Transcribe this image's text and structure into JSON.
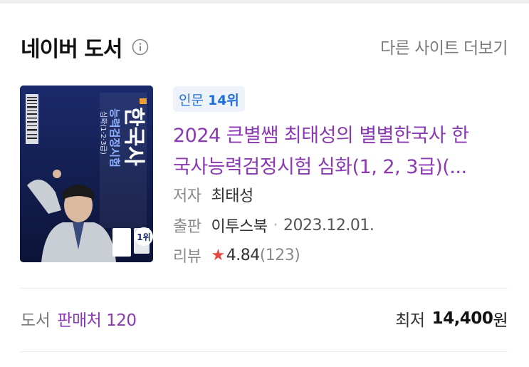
{
  "header": {
    "title": "네이버 도서",
    "more_link": "다른 사이트 더보기"
  },
  "book": {
    "cover": {
      "title_text": "한국사",
      "subtitle_text": "능력검정시험",
      "level_text": "심화(1·2·3급)",
      "badge_text": "1위"
    },
    "rank_category": "인문",
    "rank_value": "14위",
    "title_line1": "2024 큰별쌤 최태성의 별별한국사 한",
    "title_line2": "국사능력검정시험 심화(1, 2, 3급)(...",
    "author_label": "저자",
    "author": "최태성",
    "publisher_label": "출판",
    "publisher": "이투스북",
    "date": "2023.12.01.",
    "review_label": "리뷰",
    "rating": "4.84",
    "review_count": "(123)"
  },
  "footer": {
    "category": "도서",
    "sellers": "판매처 120",
    "min_label": "최저",
    "price": "14,400",
    "currency": "원"
  },
  "colors": {
    "accent_purple": "#8b3ab3",
    "badge_blue": "#1f6fd6",
    "star_red": "#e8453c"
  }
}
